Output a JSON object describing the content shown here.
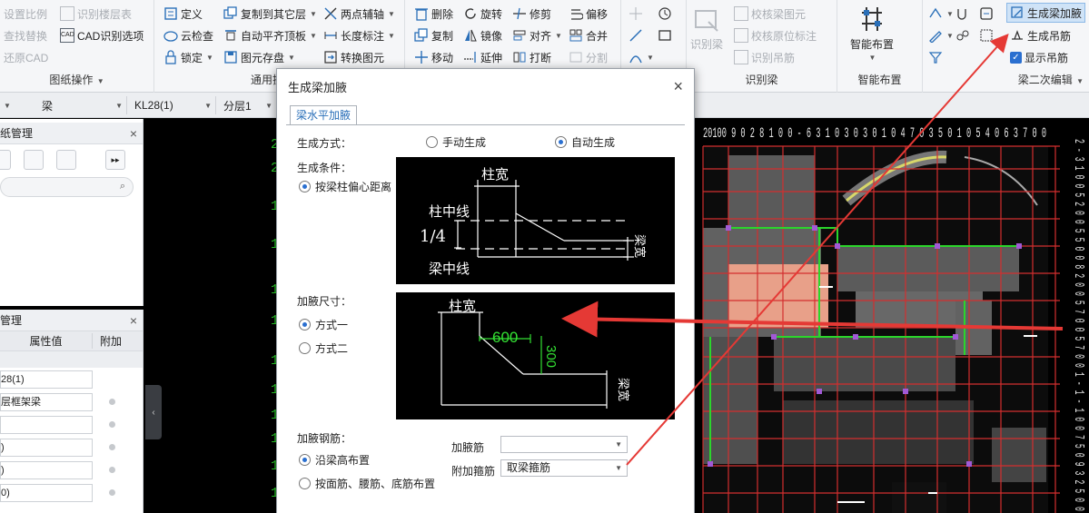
{
  "ribbon": {
    "group_drawing": {
      "label": "图纸操作",
      "items": [
        "设置比例",
        "识别楼层表",
        "查找替换",
        "CAD识别选项",
        "还原CAD"
      ]
    },
    "group_common": {
      "label": "通用操作",
      "items": [
        "定义",
        "复制到其它层",
        "两点辅轴",
        "云检查",
        "自动平齐顶板",
        "长度标注",
        "锁定",
        "图元存盘",
        "转换图元"
      ]
    },
    "group_modify": {
      "items": [
        "删除",
        "旋转",
        "修剪",
        "偏移",
        "复制",
        "镜像",
        "对齐",
        "合并",
        "移动",
        "延伸",
        "打断",
        "分割"
      ]
    },
    "group_recognize": {
      "label": "识别梁",
      "big": "识别梁",
      "items": [
        "校核梁图元",
        "校核原位标注",
        "识别吊筋"
      ]
    },
    "group_smart": {
      "label": "智能布置",
      "big": "智能布置"
    },
    "group_edit2": {
      "label": "梁二次编辑",
      "items": [
        "生成梁加腋",
        "生成吊筋",
        "显示吊筋"
      ]
    }
  },
  "selectors": {
    "type": "梁",
    "name": "KL28(1)",
    "layer": "分层1"
  },
  "left_top_panel": {
    "title": "纸管理"
  },
  "left_bottom_panel": {
    "title": "管理",
    "col_value": "属性值",
    "col_extra": "附加",
    "rows": [
      "28(1)",
      "层框架梁",
      "",
      ")",
      ")",
      "0)"
    ]
  },
  "dialog": {
    "title": "生成梁加腋",
    "tab": "梁水平加腋",
    "gen_method_label": "生成方式：",
    "manual": "手动生成",
    "auto": "自动生成",
    "condition_label": "生成条件：",
    "condition_option": "按梁柱偏心距离",
    "diagram1": {
      "col_width": "柱宽",
      "col_center": "柱中线",
      "quarter": "1/4",
      "beam_center": "梁中线",
      "beam_width": "梁宽"
    },
    "size_label": "加腋尺寸：",
    "mode1": "方式一",
    "mode2": "方式二",
    "diagram2": {
      "col_width": "柱宽",
      "dim1": "600",
      "dim2": "300",
      "beam_width": "梁宽"
    },
    "rebar_label": "加腋钢筋：",
    "rebar_opt1": "沿梁高布置",
    "rebar_opt2": "按面筋、腰筋、底筋布置",
    "haunch_bar_label": "加腋筋",
    "haunch_bar_value": "",
    "extra_stirrup_label": "附加箍筋",
    "extra_stirrup_value": "取梁箍筋"
  },
  "canvas": {
    "left_numbers": [
      "2",
      "2",
      "1",
      "1",
      "1",
      "1",
      "1",
      "1",
      "1",
      "1",
      "1",
      "1"
    ],
    "top_axis_text": "20100 9 0 2 8 1 0 0 - 6 3 1 0 3 0 3 0 1 0 4 7 0 3 5 0 1 0 5 4 0 6 3 7 0 0",
    "right_axis_text": "2 - 3 1 0 0 5 2 0 0 5 5 0 0 8 2 0 0 5 7 0 0 5 7 0 0 1 - 1 - 1 0 0 7 5 0 9 3 2 5 0 0"
  },
  "colors": {
    "ribbon_bg": "#f5f6f8",
    "highlight": "#cfe3f7",
    "arrow_red": "#e53935",
    "cad_red": "#d32f2f",
    "cad_green": "#2bd62b",
    "dim_green": "#33e033"
  }
}
